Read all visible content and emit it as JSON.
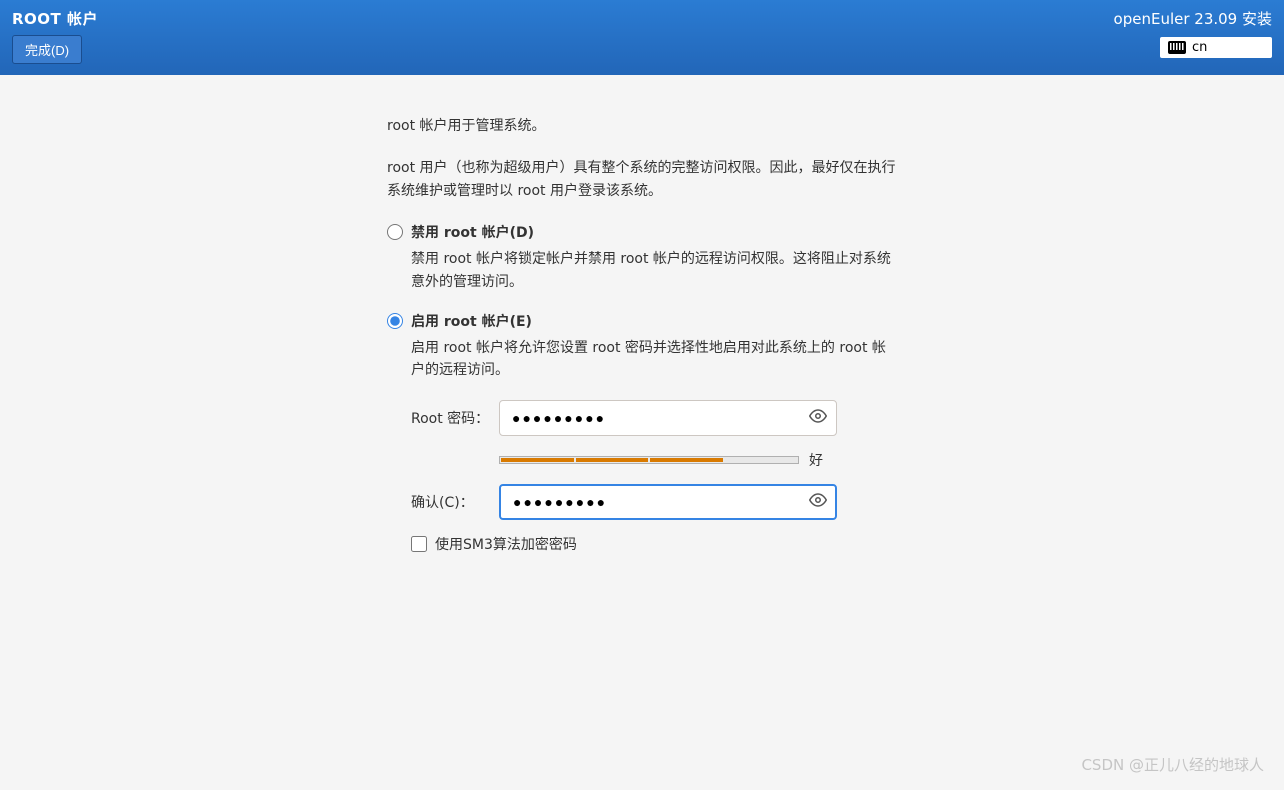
{
  "header": {
    "page_title": "ROOT 帐户",
    "done_label": "完成(D)",
    "installer_title": "openEuler 23.09 安装",
    "keyboard_layout": "cn"
  },
  "content": {
    "desc1": "root 帐户用于管理系统。",
    "desc2": "root 用户（也称为超级用户）具有整个系统的完整访问权限。因此，最好仅在执行系统维护或管理时以 root 用户登录该系统。",
    "disable": {
      "label": "禁用 root 帐户(D)",
      "desc": "禁用 root 帐户将锁定帐户并禁用 root 帐户的远程访问权限。这将阻止对系统意外的管理访问。"
    },
    "enable": {
      "label": "启用 root 帐户(E)",
      "desc": "启用 root 帐户将允许您设置 root 密码并选择性地启用对此系统上的 root 帐户的远程访问。"
    },
    "password_label": "Root 密码：",
    "password_value": "●●●●●●●●●",
    "strength_label": "好",
    "confirm_label": "确认(C)：",
    "confirm_value": "●●●●●●●●●",
    "sm3_label": "使用SM3算法加密密码"
  },
  "watermark": "CSDN @正儿八经的地球人"
}
